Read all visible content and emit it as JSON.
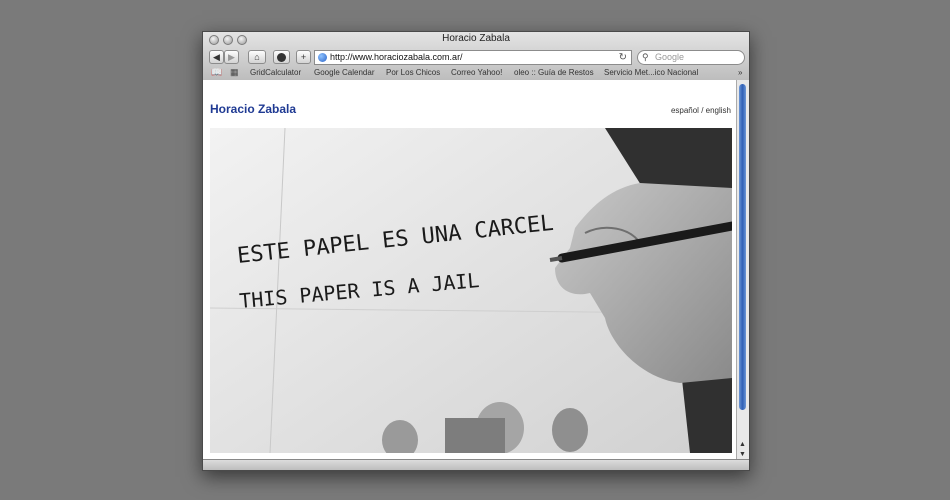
{
  "window": {
    "title": "Horacio Zabala"
  },
  "toolbar": {
    "back": "◀",
    "forward": "▶",
    "home": "⌂",
    "add": "+",
    "url": "http://www.horaciozabala.com.ar/",
    "reload": "↻",
    "search_placeholder": "Google"
  },
  "bookmarks": {
    "items": [
      "GridCalculator",
      "Google Calendar",
      "Por Los Chicos",
      "Correo Yahoo!",
      "oleo :: Guía de Restos",
      "Servicio Met...ico Nacional"
    ],
    "more": "»"
  },
  "page": {
    "site_title": "Horacio Zabala",
    "lang_es": "español",
    "lang_sep": " / ",
    "lang_en": "english",
    "handwriting_line1": "ESTE PAPEL ES UNA CARCEL",
    "handwriting_line2": "THIS PAPER IS A JAIL"
  },
  "colors": {
    "title_blue": "#1f3a93",
    "scroll_thumb": "#2f5fb5"
  }
}
